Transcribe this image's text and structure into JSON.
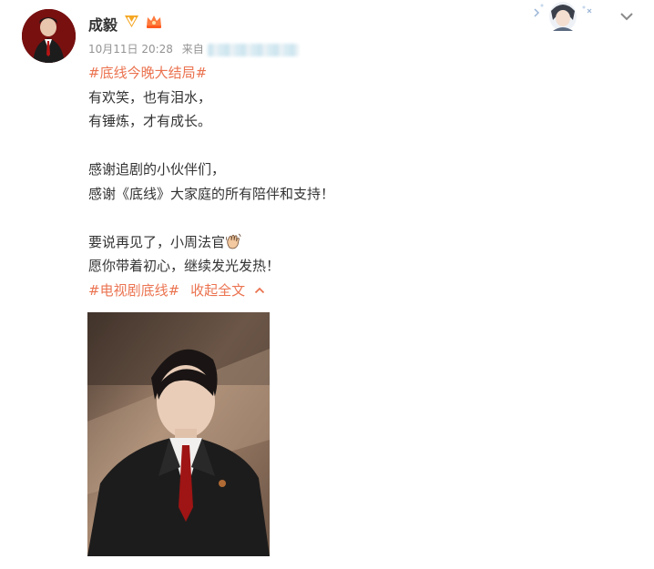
{
  "post": {
    "author": "成毅",
    "date": "10月11日 20:28",
    "source_prefix": "来自"
  },
  "content": {
    "hashtag_top": "#底线今晚大结局#",
    "line1": "有欢笑，也有泪水，",
    "line2": "有锤炼，才有成长。",
    "line3": "感谢追剧的小伙伴们，",
    "line4": "感谢《底线》大家庭的所有陪伴和支持！",
    "line5": "要说再见了，小周法官",
    "line6": "愿你带着初心，继续发光发热！",
    "hashtag_bottom": "#电视剧底线#",
    "collapse_label": "收起全文"
  },
  "colors": {
    "link": "#eb7350",
    "text": "#333333",
    "meta": "#939393"
  },
  "icons": {
    "verified": "v-badge-icon",
    "member": "crown-icon",
    "wave": "waving-hand-emoji",
    "more": "chevron-down-icon",
    "collapse": "chevron-up-icon"
  }
}
